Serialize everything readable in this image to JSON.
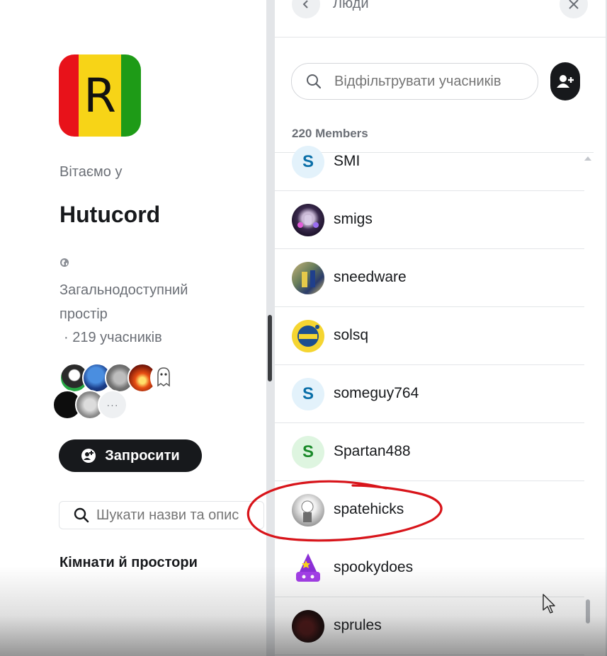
{
  "left_panel": {
    "logo_letter": "R",
    "welcome": "Вітаємо у",
    "space_name": "Hutucord",
    "visibility_icon": "globe-icon",
    "visibility": "Загальнодоступний простір",
    "members_count": "· 219 учасників",
    "more_members": "···",
    "invite_label": "Запросити",
    "search_placeholder": "Шукати назви та опис",
    "rooms_heading": "Кімнати й простори"
  },
  "people_panel": {
    "title": "Люди",
    "filter_placeholder": "Відфільтрувати учасників",
    "member_count": "220 Members",
    "members": [
      {
        "name": "SMI",
        "initial": "S",
        "avatar": "letter-blue"
      },
      {
        "name": "smigs",
        "initial": "",
        "avatar": "image-purple"
      },
      {
        "name": "sneedware",
        "initial": "",
        "avatar": "image-photo"
      },
      {
        "name": "solsq",
        "initial": "",
        "avatar": "image-yellow"
      },
      {
        "name": "someguy764",
        "initial": "S",
        "avatar": "letter-blue"
      },
      {
        "name": "Spartan488",
        "initial": "S",
        "avatar": "letter-green"
      },
      {
        "name": "spatehicks",
        "initial": "",
        "avatar": "image-grey"
      },
      {
        "name": "spookydoes",
        "initial": "",
        "avatar": "image-wizard"
      },
      {
        "name": "sprules",
        "initial": "",
        "avatar": "image-dark"
      }
    ]
  },
  "colors": {
    "accent_dark": "#17191c",
    "letter_blue_bg": "#e3f2fb",
    "letter_blue_fg": "#0a6fa8",
    "letter_green_bg": "#def5e0",
    "letter_green_fg": "#1b8a2a",
    "annotation_red": "#d8141a"
  }
}
